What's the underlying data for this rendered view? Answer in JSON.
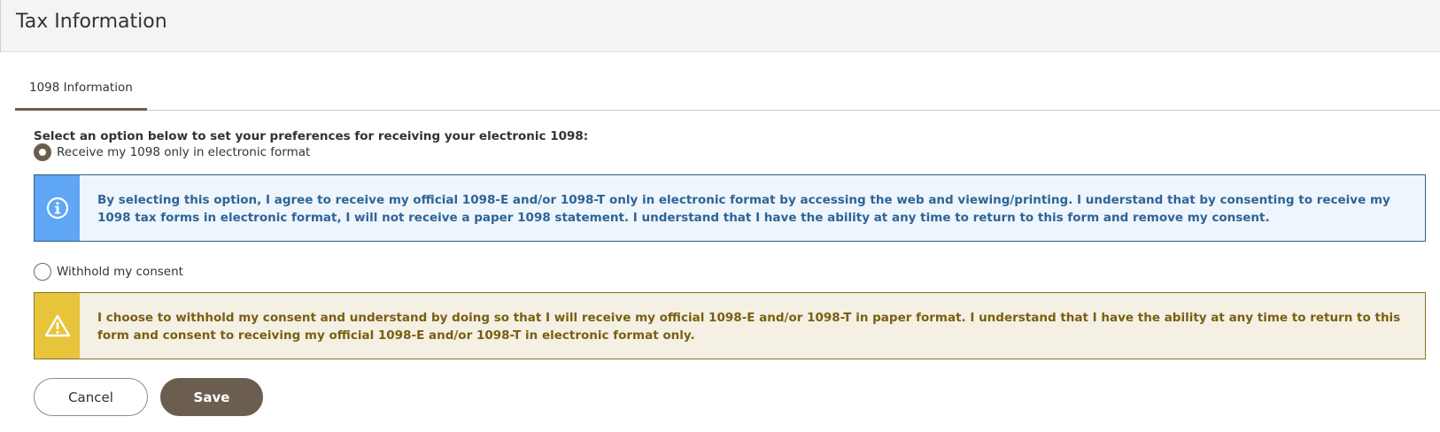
{
  "page": {
    "title": "Tax Information"
  },
  "tabs": [
    {
      "label": "1098 Information",
      "active": true
    }
  ],
  "form": {
    "prompt": "Select an option below to set your preferences for receiving your electronic 1098:",
    "options": [
      {
        "label": "Receive my 1098 only in electronic format",
        "checked": true,
        "notice_type": "info",
        "notice_icon": "info-icon",
        "notice_text": "By selecting this option, I agree to receive my official 1098-E and/or 1098-T only in electronic format by accessing the web and viewing/printing. I understand that by consenting to receive my 1098 tax forms in electronic format, I will not receive a paper 1098 statement. I understand that I have the ability at any time to return to this form and remove my consent."
      },
      {
        "label": "Withhold my consent",
        "checked": false,
        "notice_type": "warning",
        "notice_icon": "warning-icon",
        "notice_text": "I choose to withhold my consent and understand by doing so that I will receive my official 1098-E and/or 1098-T in paper format. I understand that I have the ability at any time to return to this form and consent to receiving my official 1098-E and/or 1098-T in electronic format only."
      }
    ]
  },
  "actions": {
    "cancel_label": "Cancel",
    "save_label": "Save"
  },
  "colors": {
    "primary": "#6b5e51",
    "info_accent": "#5fa6f5",
    "info_text": "#2e6497",
    "warning_accent": "#e8c43c",
    "warning_text": "#7a5f10"
  }
}
